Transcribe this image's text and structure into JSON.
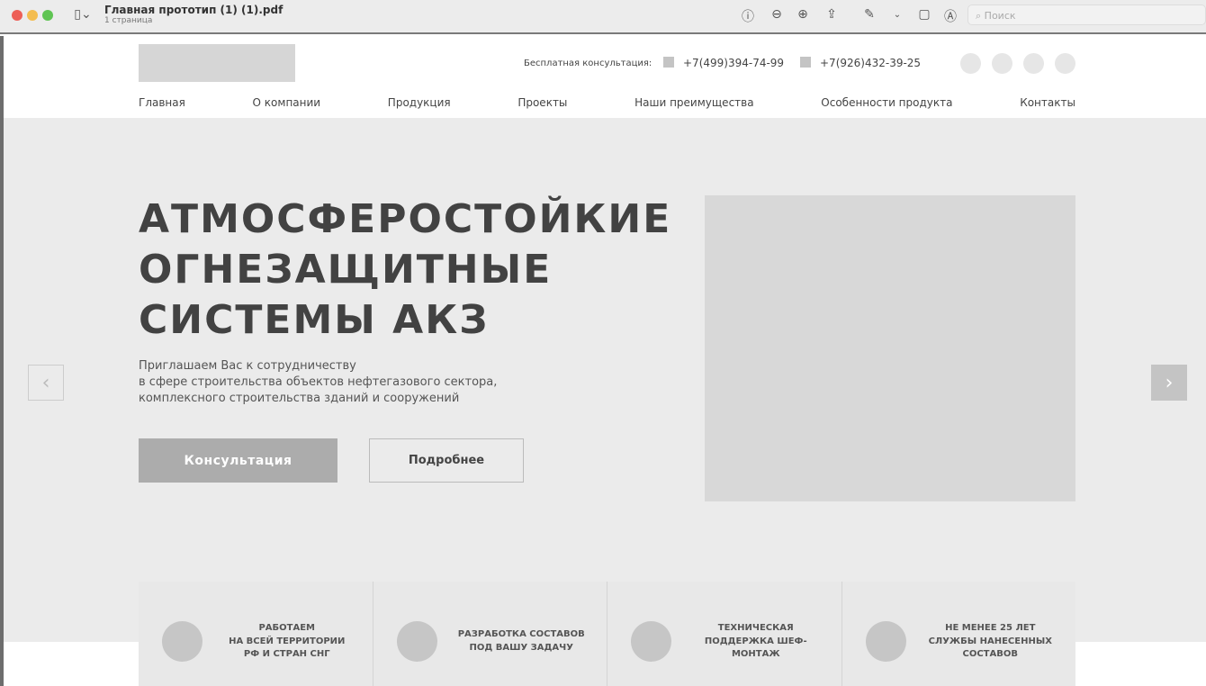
{
  "window": {
    "title": "Главная прототип (1) (1).pdf",
    "subtitle": "1 страница",
    "search_placeholder": "Поиск"
  },
  "header": {
    "consult_label": "Бесплатная консультация:",
    "phones": [
      "+7(499)394-74-99",
      "+7(926)432-39-25"
    ]
  },
  "nav": [
    "Главная",
    "О компании",
    "Продукция",
    "Проекты",
    "Наши преимущества",
    "Особенности продукта",
    "Контакты"
  ],
  "hero": {
    "title_lines": [
      "АТМОСФЕРОСТОЙКИЕ",
      "ОГНЕЗАЩИТНЫЕ",
      "СИСТЕМЫ АКЗ"
    ],
    "subtitle_lines": [
      "Приглашаем Вас к сотрудничеству",
      "в сфере строительства объектов нефтегазового сектора,",
      "комплексного строительства зданий и сооружений"
    ],
    "primary_button": "Консультация",
    "secondary_button": "Подробнее"
  },
  "features": [
    {
      "lines": [
        "РАБОТАЕМ",
        "НА ВСЕЙ ТЕРРИТОРИИ",
        "РФ И СТРАН СНГ"
      ]
    },
    {
      "lines": [
        "РАЗРАБОТКА СОСТАВОВ",
        "ПОД ВАШУ ЗАДАЧУ"
      ]
    },
    {
      "lines": [
        "ТЕХНИЧЕСКАЯ",
        "ПОДДЕРЖКА ШЕФ-",
        "МОНТАЖ"
      ]
    },
    {
      "lines": [
        "НЕ МЕНЕЕ 25 ЛЕТ",
        "СЛУЖБЫ НАНЕСЕННЫХ",
        "СОСТАВОВ"
      ]
    }
  ]
}
